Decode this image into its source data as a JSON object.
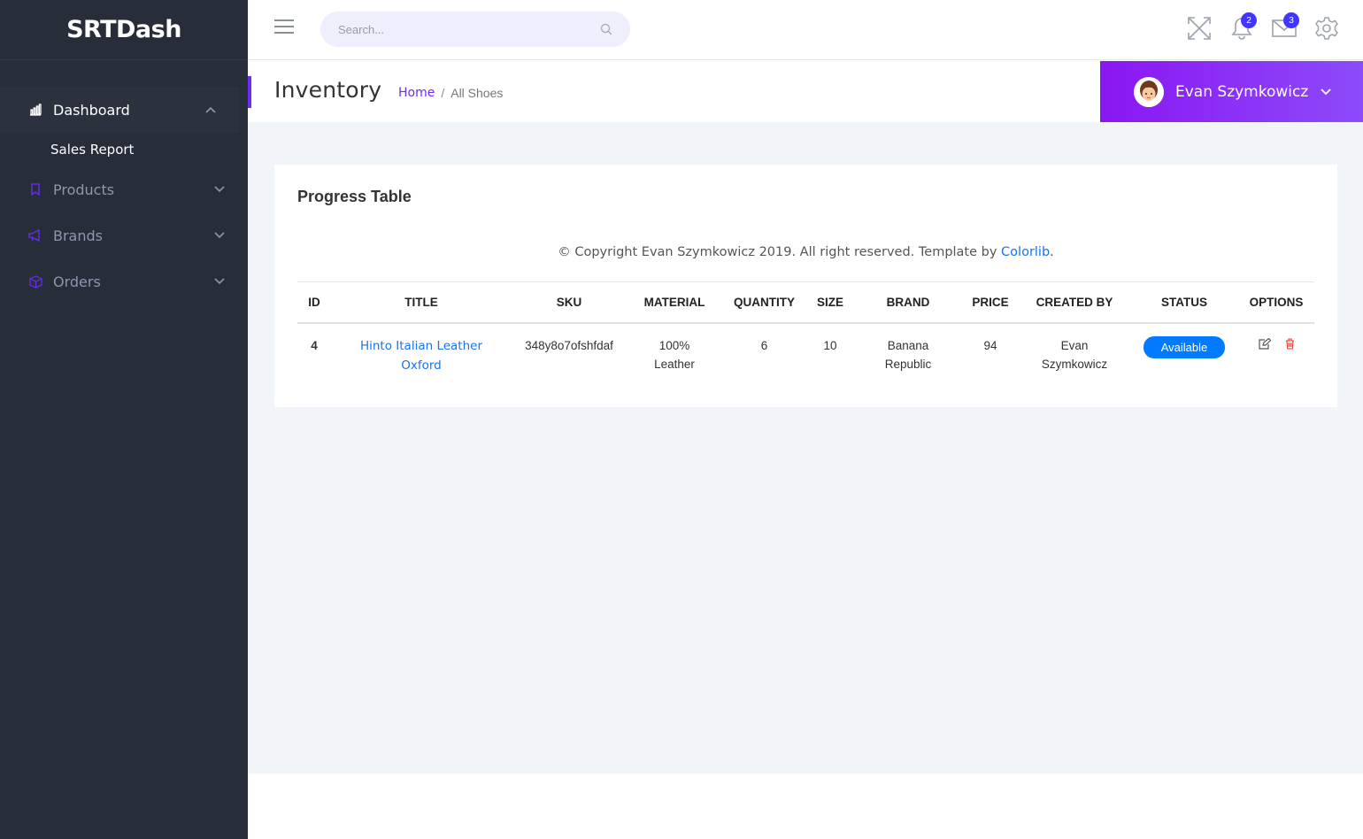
{
  "brand": {
    "name": "SRTDash"
  },
  "sidebar": {
    "items": [
      {
        "label": "Dashboard",
        "icon": "bar-chart-icon",
        "expanded": true
      },
      {
        "label": "Products",
        "icon": "bookmark-icon",
        "expanded": false
      },
      {
        "label": "Brands",
        "icon": "megaphone-icon",
        "expanded": false
      },
      {
        "label": "Orders",
        "icon": "box-icon",
        "expanded": false
      }
    ],
    "subitems": [
      {
        "label": "Sales Report"
      }
    ]
  },
  "header": {
    "search_placeholder": "Search...",
    "notifications_count": "2",
    "messages_count": "3"
  },
  "page": {
    "title": "Inventory",
    "breadcrumb": {
      "home": "Home",
      "separator": "/",
      "current": "All Shoes"
    }
  },
  "user": {
    "name": "Evan Szymkowicz"
  },
  "card": {
    "title": "Progress Table",
    "copyright_text": "© Copyright Evan Szymkowicz 2019. All right reserved. Template by",
    "copyright_link": "Colorlib",
    "copyright_end": "."
  },
  "table": {
    "columns": [
      "ID",
      "TITLE",
      "SKU",
      "MATERIAL",
      "QUANTITY",
      "SIZE",
      "BRAND",
      "PRICE",
      "CREATED BY",
      "STATUS",
      "OPTIONS"
    ],
    "rows": [
      {
        "id": "4",
        "title_line1": "Hinto Italian Leather",
        "title_line2": "Oxford",
        "sku": "348y8o7ofshfdaf",
        "material_line1": "100%",
        "material_line2": "Leather",
        "quantity": "6",
        "size": "10",
        "brand_line1": "Banana",
        "brand_line2": "Republic",
        "price": "94",
        "created_line1": "Evan",
        "created_line2": "Szymkowicz",
        "status": "Available"
      }
    ]
  },
  "colors": {
    "sidebar_bg": "#282d3a",
    "accent_purple": "#6b2df2",
    "badge_blue": "#4336fb",
    "status_blue": "#007bff",
    "link_blue": "#1a73e8",
    "delete_red": "#e53935"
  }
}
